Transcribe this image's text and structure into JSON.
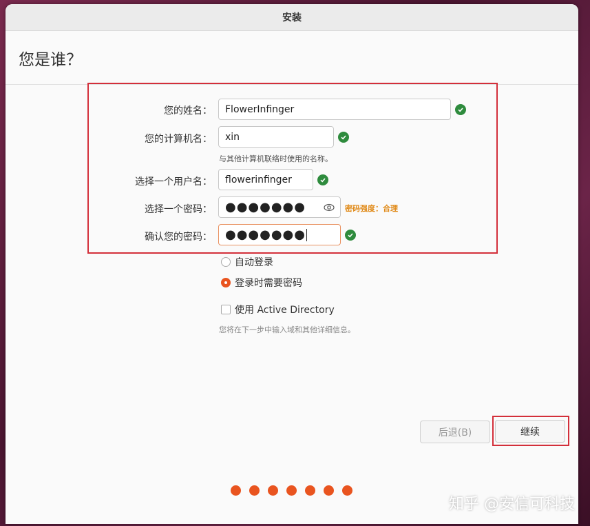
{
  "window": {
    "title": "安装"
  },
  "page": {
    "heading": "您是谁？"
  },
  "form": {
    "name": {
      "label": "您的姓名：",
      "value": "FlowerInfinger"
    },
    "computer": {
      "label": "您的计算机名：",
      "value": "xin",
      "hint": "与其他计算机联络时使用的名称。"
    },
    "username": {
      "label": "选择一个用户名：",
      "value": "flowerinfinger"
    },
    "password": {
      "label": "选择一个密码：",
      "value": "●●●●●●●",
      "strength": "密码强度：合理"
    },
    "confirm": {
      "label": "确认您的密码：",
      "value": "●●●●●●●"
    }
  },
  "login": {
    "auto_label": "自动登录",
    "require_password_label": "登录时需要密码",
    "selected": "require_password",
    "active_directory_label": "使用 Active Directory",
    "active_directory_checked": false,
    "active_directory_hint": "您将在下一步中输入域和其他详细信息。"
  },
  "buttons": {
    "back": "后退(B)",
    "continue": "继续"
  },
  "progress": {
    "total_steps": 7
  },
  "watermark": "知乎 @安信可科技",
  "colors": {
    "accent": "#e9541f",
    "check": "#2e8b3d",
    "highlight": "#d32f3a",
    "strength": "#e08a18"
  }
}
